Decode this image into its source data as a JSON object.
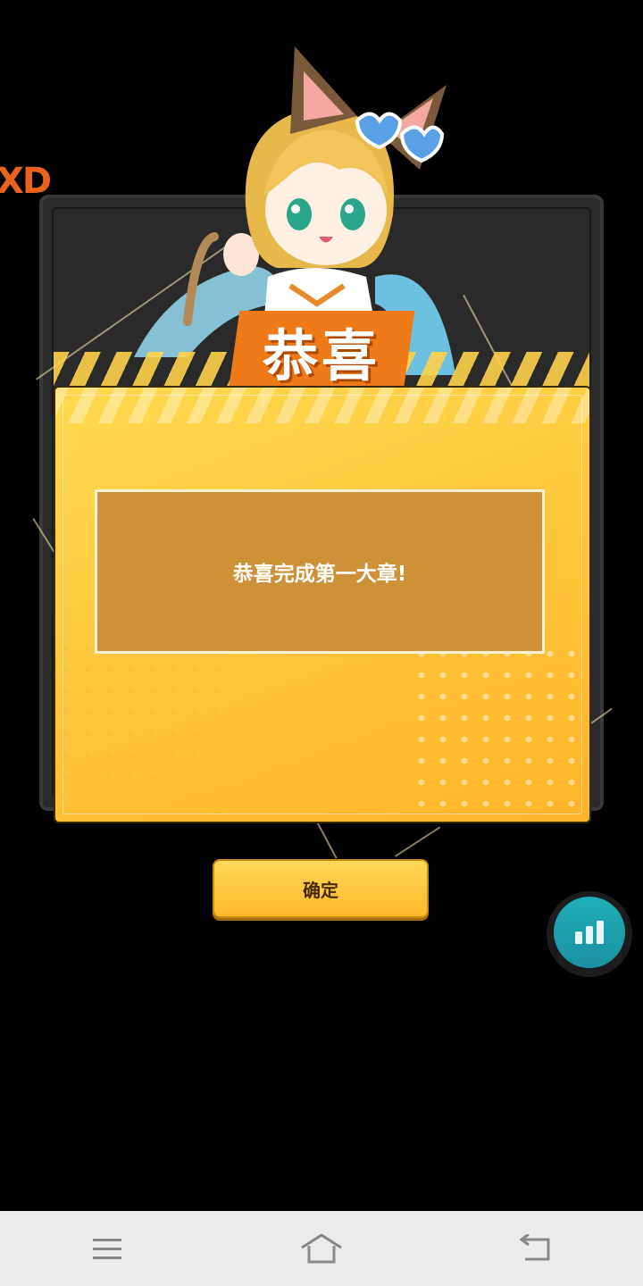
{
  "background": {
    "logo_text": "XD"
  },
  "dialog": {
    "title": "恭喜",
    "message": "恭喜完成第一大章!",
    "confirm_label": "确定"
  },
  "floating_button": {
    "icon": "bar-chart-icon"
  },
  "navbar": {
    "menu_icon": "menu-icon",
    "home_icon": "home-icon",
    "back_icon": "back-icon"
  },
  "colors": {
    "card": "#ffc53a",
    "message_box": "#cf9138",
    "title_box": "#ef7a1a",
    "fab": "#1fb0b8"
  }
}
